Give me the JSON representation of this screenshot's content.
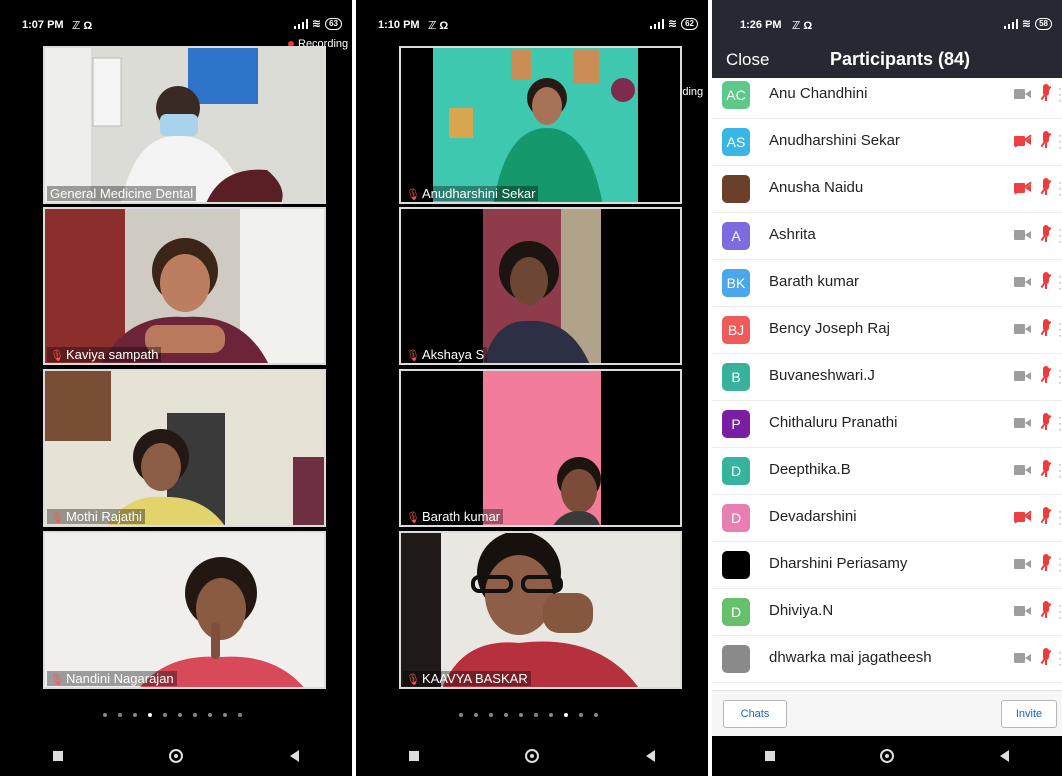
{
  "screens": [
    {
      "status": {
        "time": "1:07 PM",
        "icons": "ℤ Ω",
        "battery": "63"
      },
      "recording_label": "Recording",
      "tiles": [
        {
          "name": "General Medicine Dental",
          "muted": false,
          "scene": "doctor"
        },
        {
          "name": "Kaviya sampath",
          "muted": true,
          "scene": "girl-red"
        },
        {
          "name": "Mothi Rajathi",
          "muted": true,
          "scene": "room"
        },
        {
          "name": "Nandini Nagarajan",
          "muted": true,
          "scene": "girl-white"
        }
      ],
      "page_dots": {
        "total": 10,
        "active": 3
      }
    },
    {
      "status": {
        "time": "1:10 PM",
        "icons": "ℤ Ω",
        "battery": "62"
      },
      "recording_label": "Recording",
      "tiles": [
        {
          "name": "Anudharshini Sekar",
          "muted": true,
          "scene": "green"
        },
        {
          "name": "Akshaya S",
          "muted": true,
          "scene": "dark-girl"
        },
        {
          "name": "Barath kumar",
          "muted": true,
          "scene": "pink"
        },
        {
          "name": "KAAVYA BASKAR",
          "muted": true,
          "scene": "glasses"
        }
      ],
      "page_dots": {
        "total": 10,
        "active": 7
      }
    }
  ],
  "participants_screen": {
    "status": {
      "time": "1:26 PM",
      "icons": "ℤ Ω",
      "battery": "58"
    },
    "close_label": "Close",
    "title": "Participants (84)",
    "participants": [
      {
        "initials": "AC",
        "name": "Anu Chandhini",
        "color": "#5cc98a",
        "video_off": false
      },
      {
        "initials": "AS",
        "name": "Anudharshini Sekar",
        "color": "#39b6e3",
        "video_off": true
      },
      {
        "initials": "",
        "name": "Anusha Naidu",
        "color": "#6b3f2a",
        "video_off": true
      },
      {
        "initials": "A",
        "name": "Ashrita",
        "color": "#7f6be0",
        "video_off": false
      },
      {
        "initials": "BK",
        "name": "Barath kumar",
        "color": "#4aa7ec",
        "video_off": false
      },
      {
        "initials": "BJ",
        "name": "Bency Joseph Raj",
        "color": "#f05a5a",
        "video_off": false
      },
      {
        "initials": "B",
        "name": "Buvaneshwari.J",
        "color": "#38b29b",
        "video_off": false
      },
      {
        "initials": "P",
        "name": "Chithaluru Pranathi",
        "color": "#7b1fa2",
        "video_off": false
      },
      {
        "initials": "D",
        "name": "Deepthika.B",
        "color": "#35b39d",
        "video_off": false
      },
      {
        "initials": "D",
        "name": "Devadarshini",
        "color": "#e77fb2",
        "video_off": true
      },
      {
        "initials": "",
        "name": "Dharshini Periasamy",
        "color": "#000000",
        "video_off": false
      },
      {
        "initials": "D",
        "name": "Dhiviya.N",
        "color": "#66c16d",
        "video_off": false
      },
      {
        "initials": "",
        "name": "dhwarka mai jagatheesh",
        "color": "#8a8a8a",
        "video_off": false
      }
    ],
    "chats_label": "Chats",
    "invite_label": "Invite"
  }
}
